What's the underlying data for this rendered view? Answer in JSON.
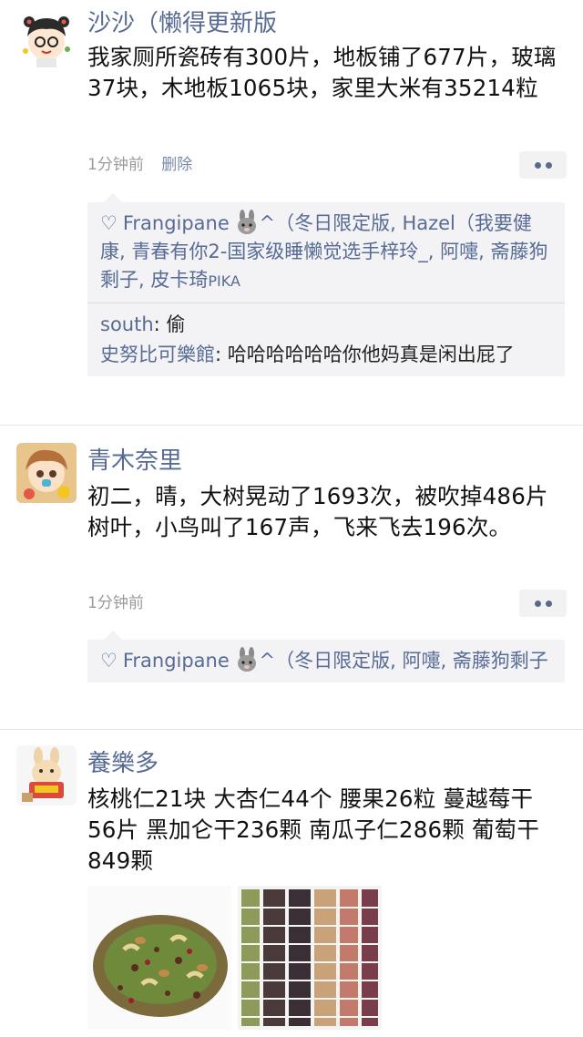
{
  "posts": [
    {
      "author": "沙沙（懒得更新版",
      "text": "我家厕所瓷砖有300片，地板铺了677片，玻璃37块，木地板1065块，家里大米有35214粒",
      "time": "1分钟前",
      "delete_label": "删除",
      "likes_prefix": "Frangipane",
      "likes_rest": "（冬日限定版, Hazel（我要健康, 青春有你2-国家级睡懒觉选手梓玲_, 阿嚏, 斋藤狗剩子, 皮卡琦",
      "likes_pika": "PIKA",
      "comments": [
        {
          "name": "south",
          "text": "偷"
        },
        {
          "name": "史努比可樂館",
          "text": "哈哈哈哈哈哈你他妈真是闲出屁了"
        }
      ]
    },
    {
      "author": "青木奈里",
      "text": "初二，晴，大树晃动了1693次，被吹掉486片树叶，小鸟叫了167声，飞来飞去196次。",
      "time": "1分钟前",
      "likes_prefix": "Frangipane",
      "likes_rest": "（冬日限定版, 阿嚏, 斋藤狗剩子"
    },
    {
      "author": "養樂多",
      "text": "核桃仁21块 大杏仁44个 腰果26粒 蔓越莓干56片 黑加仑干236颗 南瓜子仁286颗 葡萄干849颗"
    }
  ],
  "colors": {
    "link": "#576b95",
    "meta": "#9a9a9a",
    "bg": "#ffffff",
    "panel": "#f3f3f5"
  }
}
